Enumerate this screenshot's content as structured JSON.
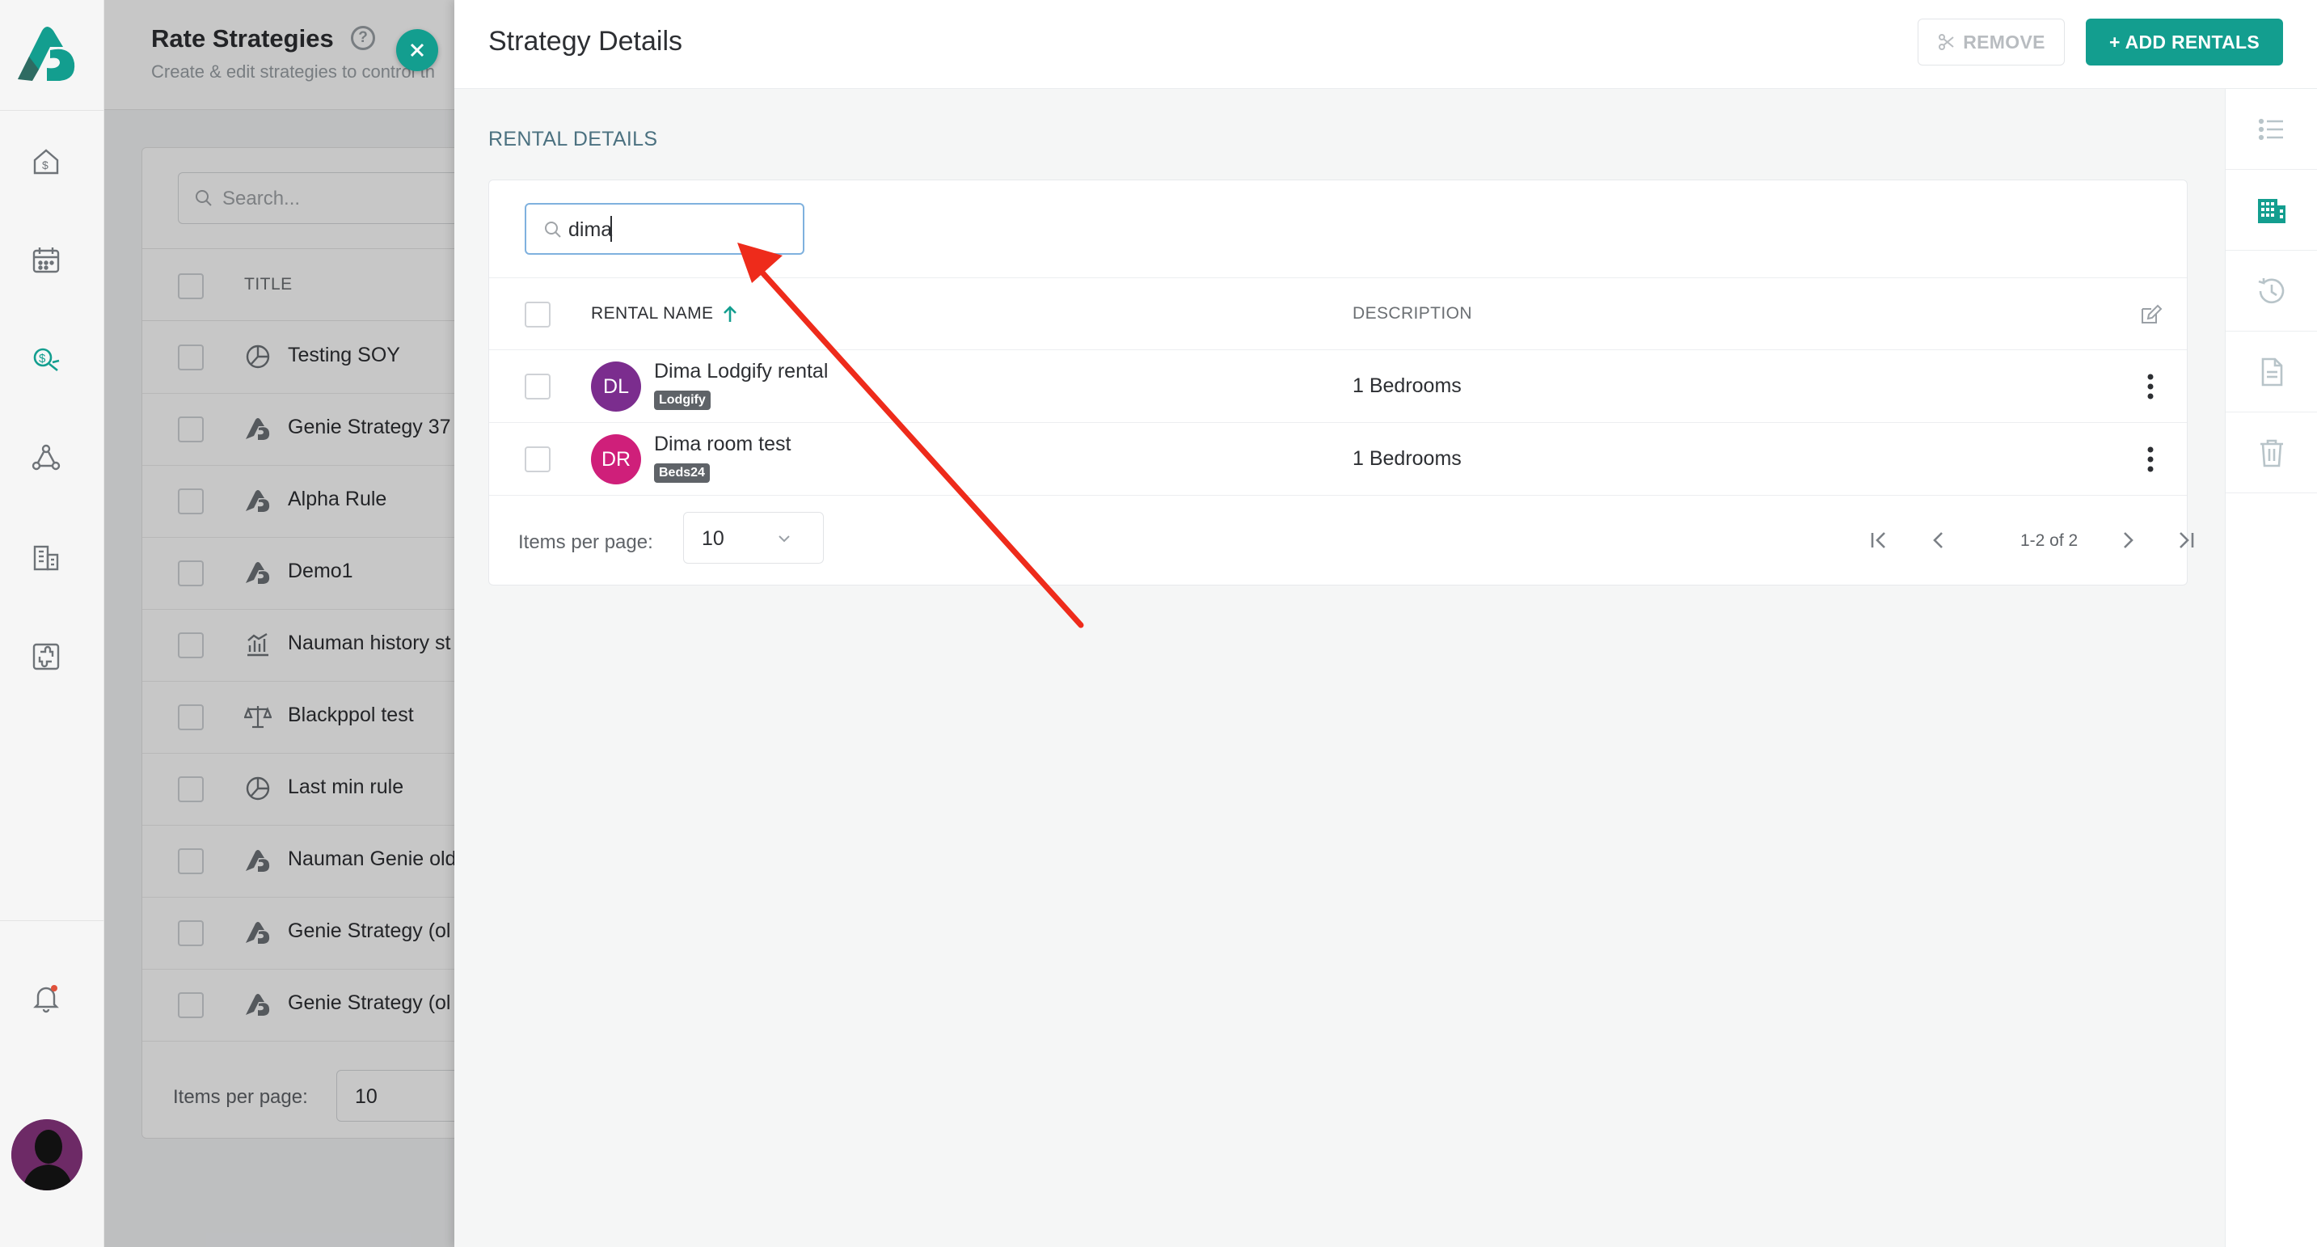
{
  "app": {
    "accent": "#139e8f",
    "brand_dark": "#2e6b62"
  },
  "rail": {
    "logo_icon": "rategenie-logo",
    "items": [
      {
        "name": "pricing-house-icon"
      },
      {
        "name": "calendar-icon"
      },
      {
        "name": "rate-strategies-icon",
        "active": true
      },
      {
        "name": "channels-icon"
      },
      {
        "name": "buildings-icon"
      },
      {
        "name": "integrations-icon"
      }
    ],
    "notification_icon": "bell-icon",
    "notification_color": "#e0513b"
  },
  "background_page": {
    "title": "Rate Strategies",
    "subtitle": "Create & edit strategies to control th",
    "search_placeholder": "Search...",
    "column_title": "TITLE",
    "rows": [
      {
        "icon": "pie-chart-icon",
        "title": "Testing SOY"
      },
      {
        "icon": "genie-icon",
        "title": "Genie Strategy 37"
      },
      {
        "icon": "genie-icon",
        "title": "Alpha Rule"
      },
      {
        "icon": "genie-icon",
        "title": "Demo1"
      },
      {
        "icon": "bar-history-icon",
        "title": "Nauman history st"
      },
      {
        "icon": "balance-scale-icon",
        "title": "Blackppol test"
      },
      {
        "icon": "pie-chart-icon",
        "title": "Last min rule"
      },
      {
        "icon": "genie-icon",
        "title": "Nauman Genie old"
      },
      {
        "icon": "genie-icon",
        "title": "Genie Strategy (ol"
      },
      {
        "icon": "genie-icon",
        "title": "Genie Strategy (ol"
      }
    ],
    "items_per_page_label": "Items per page:",
    "items_per_page_value": "10"
  },
  "drawer": {
    "title": "Strategy Details",
    "remove_label": "REMOVE",
    "add_label": "+ ADD RENTALS",
    "section_title": "RENTAL DETAILS",
    "search_value": "dima",
    "columns": {
      "name": "RENTAL NAME",
      "description": "DESCRIPTION"
    },
    "rentals": [
      {
        "initials": "DL",
        "avatar_color": "#7b2d8e",
        "name": "Dima Lodgify rental",
        "channel": "Lodgify",
        "description": "1 Bedrooms"
      },
      {
        "initials": "DR",
        "avatar_color": "#cf1f7a",
        "name": "Dima room test",
        "channel": "Beds24",
        "description": "1 Bedrooms"
      }
    ],
    "items_per_page_label": "Items per page:",
    "items_per_page_value": "10",
    "range_label": "1-2 of 2",
    "right_rail": [
      {
        "name": "list-icon"
      },
      {
        "name": "building-grid-icon",
        "active": true
      },
      {
        "name": "history-icon"
      },
      {
        "name": "document-icon"
      },
      {
        "name": "trash-icon"
      }
    ]
  },
  "annotation": {
    "color": "#ee2b1b"
  }
}
